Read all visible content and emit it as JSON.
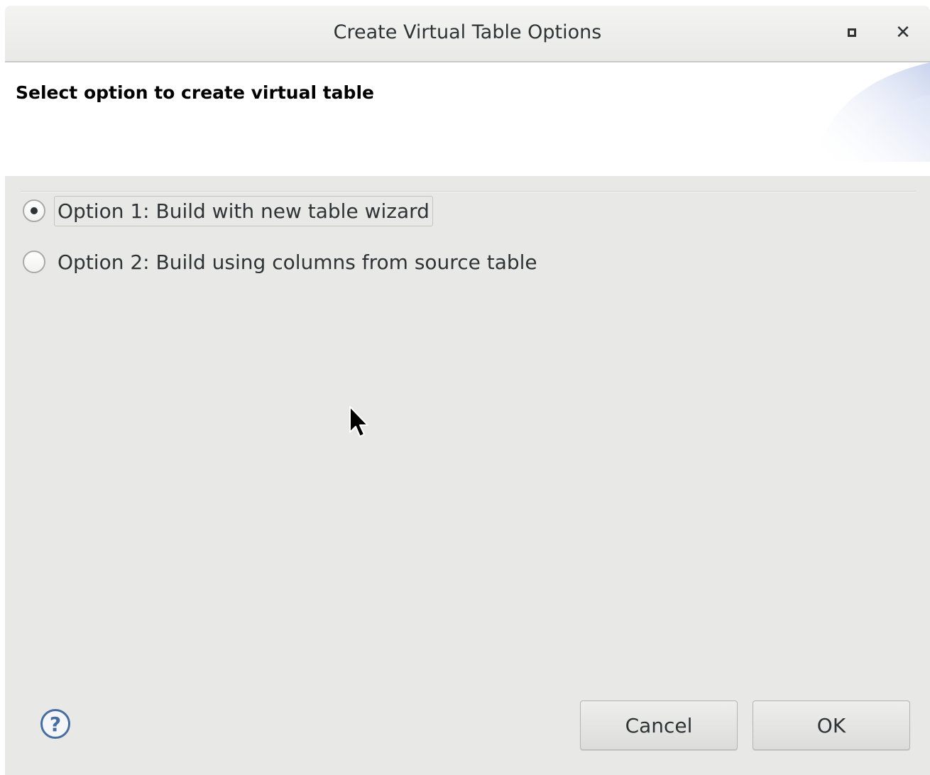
{
  "window": {
    "title": "Create Virtual Table Options",
    "maximize_icon": "maximize-icon",
    "close_icon": "close-icon"
  },
  "header": {
    "title": "Select option to create virtual table"
  },
  "options": [
    {
      "label": "Option 1: Build with new table wizard",
      "selected": true
    },
    {
      "label": "Option 2: Build using columns from source table",
      "selected": false
    }
  ],
  "footer": {
    "help_symbol": "?",
    "cancel_label": "Cancel",
    "ok_label": "OK"
  },
  "colors": {
    "background": "#e8e8e7",
    "text": "#2e3436",
    "help_accent": "#4a6da0"
  }
}
